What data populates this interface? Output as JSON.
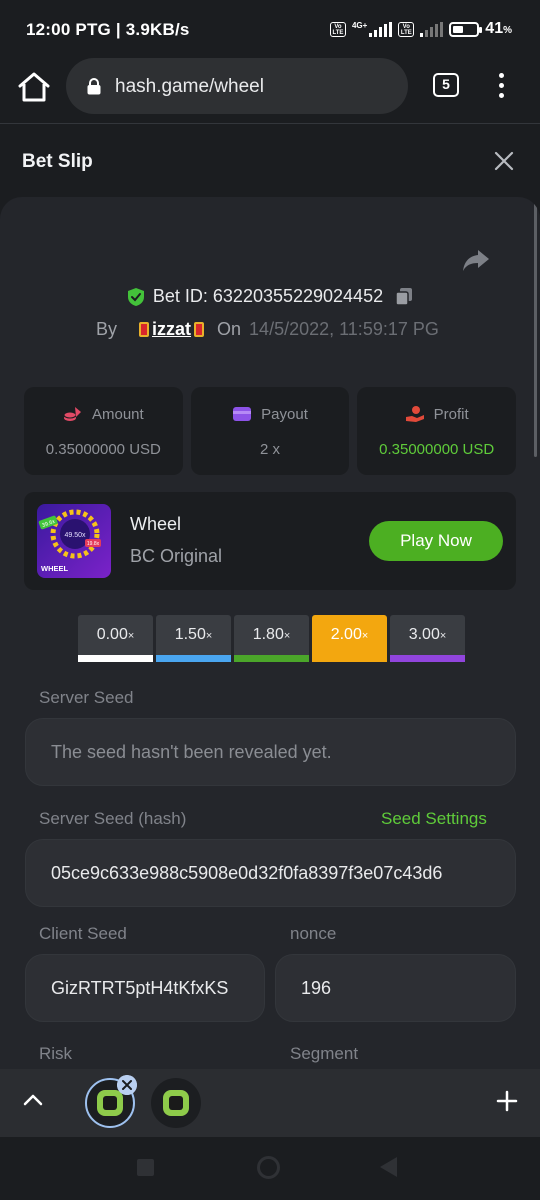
{
  "status_bar": {
    "time": "12:00 PTG | 3.9KB/s",
    "network_label": "4G+",
    "volte": "Vo LTE",
    "battery": "41",
    "battery_unit": "%"
  },
  "browser": {
    "url": "hash.game/wheel",
    "tab_count": "5"
  },
  "slip": {
    "title": "Bet Slip"
  },
  "bet": {
    "id_label": "Bet ID: 63220355229024452",
    "by": "By",
    "user": "izzat",
    "on": "On",
    "date": "14/5/2022, 11:59:17 PG"
  },
  "stats": [
    {
      "label": "Amount",
      "value": "0.35000000 USD",
      "icon": "coins-icon",
      "color": "#e24a66"
    },
    {
      "label": "Payout",
      "value": "2 x",
      "icon": "wallet-icon",
      "color": "#8d53e8"
    },
    {
      "label": "Profit",
      "value": "0.35000000 USD",
      "icon": "profit-hand-icon",
      "color": "#e24a3a"
    }
  ],
  "game": {
    "name": "Wheel",
    "provider": "BC Original",
    "thumb_label": "WHEEL",
    "thumb_values": [
      "39.6x",
      "49.50x",
      "19.8x"
    ],
    "play_label": "Play Now"
  },
  "multipliers": [
    {
      "label": "0.00",
      "bar": "#ffffff",
      "active": false
    },
    {
      "label": "1.50",
      "bar": "#4aa6f0",
      "active": false
    },
    {
      "label": "1.80",
      "bar": "#4ba62a",
      "active": false
    },
    {
      "label": "2.00",
      "bar": "#f3a70f",
      "active": true
    },
    {
      "label": "3.00",
      "bar": "#9145dd",
      "active": false
    }
  ],
  "multiplier_suffix": "×",
  "fields": {
    "server_seed_label": "Server Seed",
    "server_seed_value": "The seed hasn't been revealed yet.",
    "server_seed_hash_label": "Server Seed (hash)",
    "seed_settings_label": "Seed Settings",
    "server_seed_hash_value": "05ce9c633e988c5908e0d32f0fa8397f3e07c43d6",
    "client_seed_label": "Client Seed",
    "client_seed_value": "GizRTRT5ptH4tKfxKS",
    "nonce_label": "nonce",
    "nonce_value": "196",
    "risk_label": "Risk",
    "segment_label": "Segment"
  },
  "colors": {
    "accent_green": "#5fcb3a",
    "play_button": "#4caf22",
    "active_multiplier": "#f3a70f"
  }
}
